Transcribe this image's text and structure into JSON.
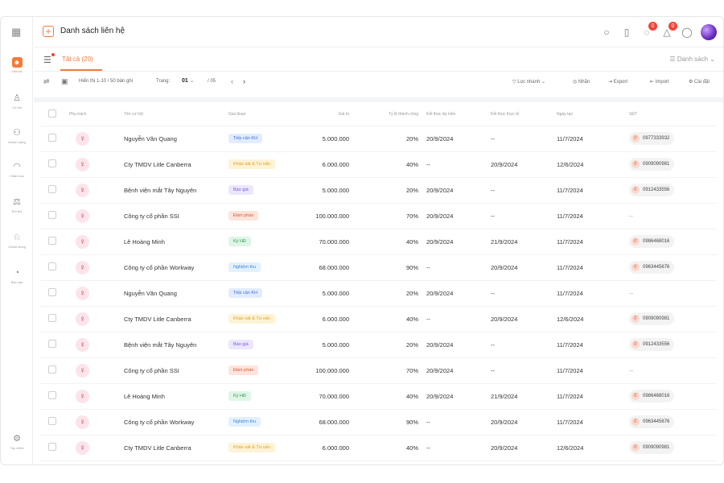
{
  "sidebar": {
    "items": [
      {
        "label": "Liên hệ",
        "icon": "contact-icon",
        "active": true
      },
      {
        "label": "Cơ hội",
        "icon": "thumbs-up-icon",
        "active": false
      },
      {
        "label": "Khách hàng",
        "icon": "users-icon",
        "active": false
      },
      {
        "label": "Chăm sóc",
        "icon": "headset-icon",
        "active": false
      },
      {
        "label": "Đối thủ",
        "icon": "scale-icon",
        "active": false
      },
      {
        "label": "Check-trong",
        "icon": "user-check-icon",
        "active": false
      },
      {
        "label": "Báo cáo",
        "icon": "pie-chart-icon",
        "active": false
      }
    ],
    "bottom_label": "Tùy chỉnh"
  },
  "header": {
    "title": "Danh sách liên hệ",
    "notif_badge_1": "0",
    "notif_badge_2": "0"
  },
  "tabs": {
    "active_label": "Tất cả (20)",
    "view_label": "Danh sách"
  },
  "toolbar": {
    "range_text": "Hiển thị 1-10 / 50 bản ghi",
    "page_label": "Trang:",
    "page_current": "01",
    "page_total": "/ 05",
    "filter_label": "Lọc nhanh",
    "tag_label": "Nhãn",
    "export_label": "Export",
    "import_label": "Import",
    "settings_label": "Cài đặt"
  },
  "table": {
    "columns": [
      "Phụ trách",
      "Tên cơ hội",
      "Giai đoạn",
      "Giá trị",
      "Tỷ lệ thành công",
      "Kết thúc dự kiến",
      "Kết thúc thực tế",
      "Ngày tạo",
      "SĐT"
    ],
    "rows": [
      {
        "name": "Nguyễn Văn Quang",
        "stage": "Tiếp cận KH",
        "stage_color": "blue",
        "value": "5.000.000",
        "rate": "20%",
        "expected": "20/9/2024",
        "actual": "--",
        "created": "11/7/2024",
        "phone": "0977333932"
      },
      {
        "name": "Cty TMDV Litle Canberra",
        "stage": "Khảo sát & Tư vấn",
        "stage_color": "yellow",
        "value": "6.000.000",
        "rate": "40%",
        "expected": "--",
        "actual": "20/9/2024",
        "created": "12/6/2024",
        "phone": "0909090981"
      },
      {
        "name": "Bệnh viện mắt Tây Nguyên",
        "stage": "Báo giá",
        "stage_color": "purple",
        "value": "5.000.000",
        "rate": "20%",
        "expected": "20/9/2024",
        "actual": "--",
        "created": "11/7/2024",
        "phone": "0912433556"
      },
      {
        "name": "Công ty cổ phần SSI",
        "stage": "Đàm phán",
        "stage_color": "red",
        "value": "100.000.000",
        "rate": "70%",
        "expected": "20/9/2024",
        "actual": "--",
        "created": "11/7/2024",
        "phone": "--"
      },
      {
        "name": "Lê Hoàng Minh",
        "stage": "Ký HĐ",
        "stage_color": "green",
        "value": "70.000.000",
        "rate": "40%",
        "expected": "20/9/2024",
        "actual": "21/9/2024",
        "created": "11/7/2024",
        "phone": "0986468016"
      },
      {
        "name": "Công ty cổ phần Workway",
        "stage": "Nghiệm thu",
        "stage_color": "lightblue",
        "value": "68.000.000",
        "rate": "90%",
        "expected": "--",
        "actual": "20/9/2024",
        "created": "11/7/2024",
        "phone": "0963445676"
      },
      {
        "name": "Nguyễn Văn Quang",
        "stage": "Tiếp cận KH",
        "stage_color": "blue",
        "value": "5.000.000",
        "rate": "20%",
        "expected": "20/9/2024",
        "actual": "--",
        "created": "11/7/2024",
        "phone": "--"
      },
      {
        "name": "Cty TMDV Litle Canberra",
        "stage": "Khảo sát & Tư vấn",
        "stage_color": "yellow",
        "value": "6.000.000",
        "rate": "40%",
        "expected": "--",
        "actual": "20/9/2024",
        "created": "12/6/2024",
        "phone": "0909090981"
      },
      {
        "name": "Bệnh viện mắt Tây Nguyên",
        "stage": "Báo giá",
        "stage_color": "purple",
        "value": "5.000.000",
        "rate": "20%",
        "expected": "20/9/2024",
        "actual": "--",
        "created": "11/7/2024",
        "phone": "0912433556"
      },
      {
        "name": "Công ty cổ phần SSI",
        "stage": "Đàm phán",
        "stage_color": "red",
        "value": "100.000.000",
        "rate": "70%",
        "expected": "20/9/2024",
        "actual": "--",
        "created": "11/7/2024",
        "phone": "--"
      },
      {
        "name": "Lê Hoàng Minh",
        "stage": "Ký HĐ",
        "stage_color": "green",
        "value": "70.000.000",
        "rate": "40%",
        "expected": "20/9/2024",
        "actual": "21/9/2024",
        "created": "11/7/2024",
        "phone": "0986468016"
      },
      {
        "name": "Công ty cổ phần Workway",
        "stage": "Nghiệm thu",
        "stage_color": "lightblue",
        "value": "68.000.000",
        "rate": "90%",
        "expected": "--",
        "actual": "20/9/2024",
        "created": "11/7/2024",
        "phone": "0963445676"
      },
      {
        "name": "Cty TMDV Litle Canberra",
        "stage": "Khảo sát & Tư vấn",
        "stage_color": "yellow",
        "value": "6.000.000",
        "rate": "40%",
        "expected": "--",
        "actual": "20/9/2024",
        "created": "12/6/2024",
        "phone": "0909090981"
      }
    ]
  },
  "colors": {
    "accent": "#f37b3a",
    "blue": "#e3ecff|#3b6fe0",
    "yellow": "#fff3d6|#d9a21b",
    "purple": "#ece6ff|#7b5ce0",
    "red": "#ffe4dc|#d9573a",
    "green": "#dff5e6|#2f9e5a",
    "lightblue": "#e2f0ff|#3d88d9"
  }
}
